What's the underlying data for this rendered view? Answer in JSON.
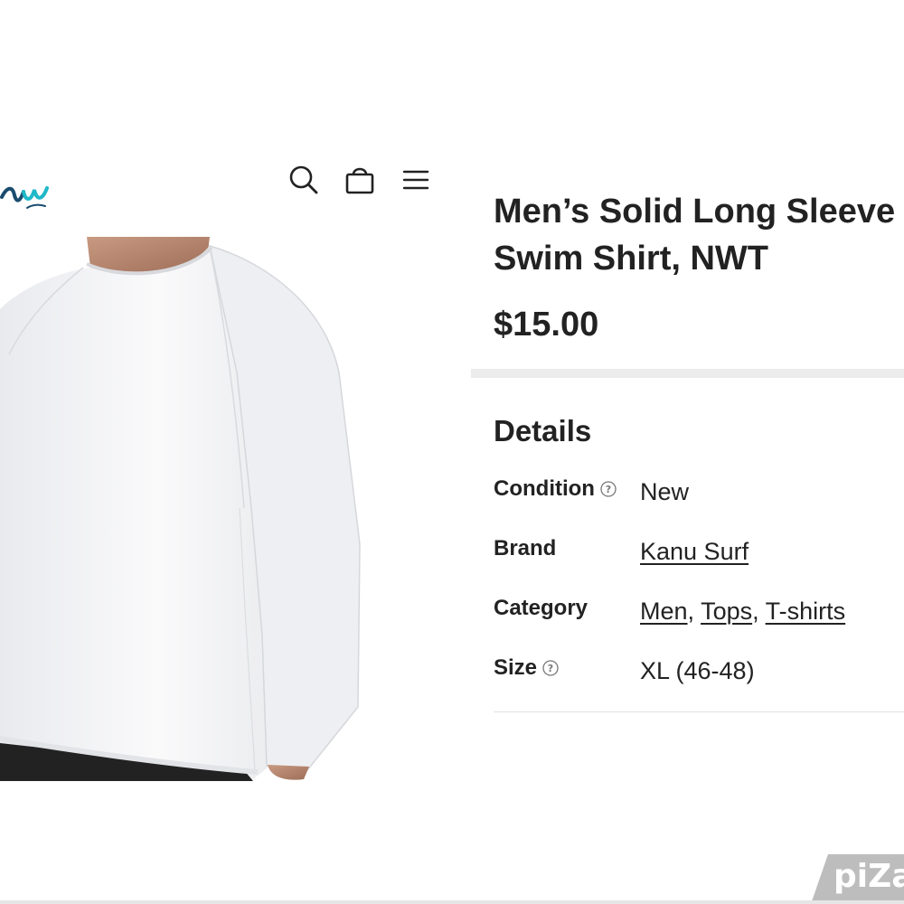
{
  "header": {
    "logo_text": "Kanu",
    "icons": [
      "search-icon",
      "cart-icon",
      "menu-icon"
    ]
  },
  "product": {
    "title_line1": "Men’s Solid Long Sleeve",
    "title_line2": "Swim Shirt, NWT",
    "price": "$15.00",
    "image_alt": "Men's white long sleeve swim shirt"
  },
  "details": {
    "heading": "Details",
    "rows": [
      {
        "label": "Condition",
        "value": "New",
        "has_help": true
      },
      {
        "label": "Brand",
        "value": "Kanu Surf",
        "has_help": false
      },
      {
        "label": "Category",
        "values": [
          "Men",
          "Tops",
          "T-shirts"
        ],
        "separator": ",",
        "has_help": false
      },
      {
        "label": "Size",
        "value": "XL (46-48)",
        "has_help": true
      }
    ]
  },
  "watermark": {
    "text": "piZa"
  },
  "colors": {
    "text": "#222222",
    "divider": "#ececec",
    "logo_accent": "#1fb8c8",
    "watermark": "#bdbdbd"
  }
}
